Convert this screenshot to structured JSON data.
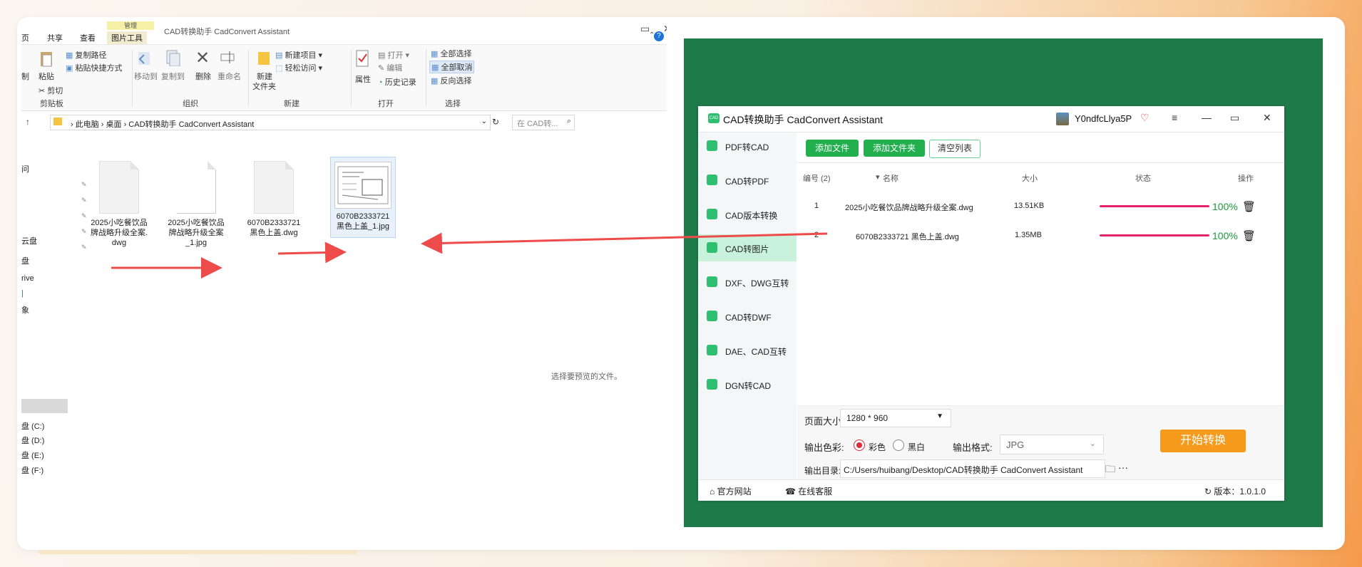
{
  "explorer": {
    "window_title": "CAD转换助手 CadConvert Assistant",
    "context_tab_label": "管理",
    "tabs": [
      {
        "label": "页"
      },
      {
        "label": "共享"
      },
      {
        "label": "查看"
      },
      {
        "label": "图片工具"
      }
    ],
    "ribbon": {
      "clipboard": {
        "cut_partial": "制",
        "paste": "粘贴",
        "copy_path": "复制路径",
        "paste_shortcut": "粘贴快捷方式",
        "cut": "剪切",
        "group": "剪贴板"
      },
      "organize": {
        "move_to": "移动到",
        "copy_to": "复制到",
        "delete": "删除",
        "rename": "重命名",
        "group": "组织"
      },
      "new": {
        "new_folder_line1": "新建",
        "new_folder_line2": "文件夹",
        "new_item": "新建项目",
        "easy_access": "轻松访问",
        "group": "新建"
      },
      "open": {
        "properties": "属性",
        "open": "打开",
        "edit": "编辑",
        "history": "历史记录",
        "group": "打开"
      },
      "select": {
        "select_all": "全部选择",
        "select_none": "全部取消",
        "invert": "反向选择",
        "group": "选择"
      }
    },
    "address": {
      "segments": [
        "此电脑",
        "桌面",
        "CAD转换助手 CadConvert Assistant"
      ],
      "search_placeholder": "在 CAD转..."
    },
    "nav_items": [
      "问",
      "云盘",
      "盘",
      "rive",
      "象"
    ],
    "drives": [
      "盘 (C:)",
      "盘 (D:)",
      "盘 (E:)",
      "盘 (F:)"
    ],
    "files": [
      {
        "line1": "2025小吃餐饮品",
        "line2": "牌战略升级全案.",
        "line3": "dwg"
      },
      {
        "line1": "2025小吃餐饮品",
        "line2": "牌战略升级全案",
        "line3": "_1.jpg"
      },
      {
        "line1": "6070B2333721",
        "line2": "黑色上盖.dwg",
        "line3": ""
      },
      {
        "line1": "6070B2333721",
        "line2": "黑色上盖_1.jpg",
        "line3": ""
      }
    ],
    "preview_hint": "选择要预览的文件。"
  },
  "app": {
    "logo_text": "CAD",
    "title": "CAD转换助手 CadConvert Assistant",
    "user": "Y0ndfcLlya5P",
    "sidebar": [
      {
        "label": "PDF转CAD"
      },
      {
        "label": "CAD转PDF"
      },
      {
        "label": "CAD版本转换"
      },
      {
        "label": "CAD转图片"
      },
      {
        "label": "DXF、DWG互转"
      },
      {
        "label": "CAD转DWF"
      },
      {
        "label": "DAE、CAD互转"
      },
      {
        "label": "DGN转CAD"
      }
    ],
    "toolbar": {
      "add_file": "添加文件",
      "add_folder": "添加文件夹",
      "clear_list": "清空列表"
    },
    "table": {
      "headers": {
        "index": "编号 (2)",
        "name": "名称",
        "size": "大小",
        "status": "状态",
        "action": "操作"
      },
      "rows": [
        {
          "index": "1",
          "name": "2025小吃餐饮品牌战略升级全案.dwg",
          "size": "13.51KB",
          "progress": 1.0,
          "pct": "100%"
        },
        {
          "index": "2",
          "name": "6070B2333721 黑色上盖.dwg",
          "size": "1.35MB",
          "progress": 1.0,
          "pct": "100%"
        }
      ]
    },
    "options": {
      "page_size_label": "页面大小:",
      "page_size_value": "1280 * 960",
      "color_label": "输出色彩:",
      "color_option": "彩色",
      "bw_option": "黑白",
      "format_label": "输出格式:",
      "format_value": "JPG",
      "dir_label": "输出目录:",
      "dir_value": "C:/Users/huibang/Desktop/CAD转换助手 CadConvert Assistant",
      "start_button": "开始转换"
    },
    "footer": {
      "website": "官方网站",
      "support": "在线客服",
      "version": "版本：1.0.1.0"
    }
  },
  "colors": {
    "green_bg": "#1f7a4a",
    "accent_green": "#22b04e",
    "progress": "#e5236b",
    "start": "#f59a1c",
    "arrow": "#ee4b4b"
  }
}
